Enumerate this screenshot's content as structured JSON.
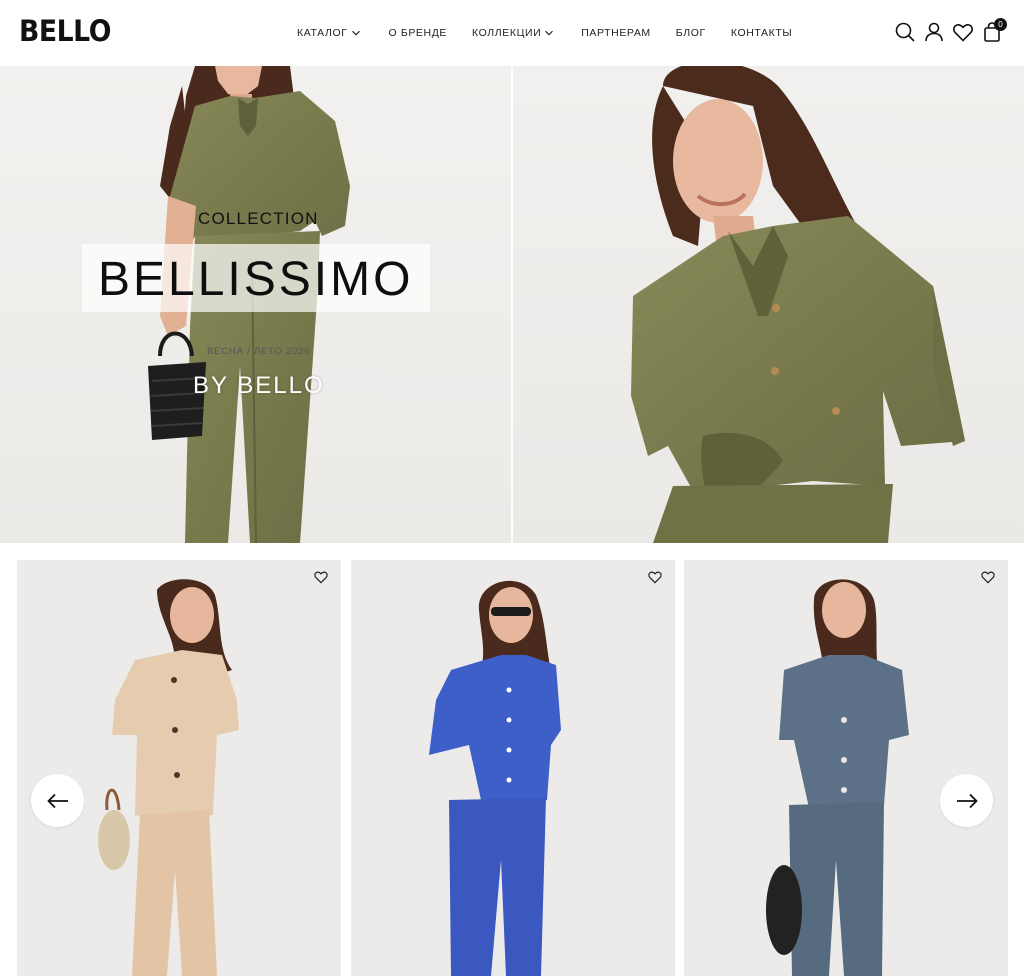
{
  "header": {
    "logo": "BELLO",
    "nav": [
      {
        "label": "КАТАЛОГ",
        "has_dropdown": true
      },
      {
        "label": "О БРЕНДЕ",
        "has_dropdown": false
      },
      {
        "label": "КОЛЛЕКЦИИ",
        "has_dropdown": true
      },
      {
        "label": "ПАРТНЕРАМ",
        "has_dropdown": false
      },
      {
        "label": "БЛОГ",
        "has_dropdown": false
      },
      {
        "label": "КОНТАКТЫ",
        "has_dropdown": false
      }
    ],
    "icons": [
      "search-icon",
      "user-icon",
      "heart-icon",
      "bag-icon"
    ],
    "cart_count": "0"
  },
  "hero": {
    "collection_label": "COLLECTION",
    "title": "BELLISSIMO",
    "season": "ВЕСНА / ЛЕТО 2026",
    "by_line": "BY BELLO"
  },
  "products": [
    {
      "color": "#e6ccae",
      "name": "beige-linen-suit"
    },
    {
      "color": "#3f5fc8",
      "name": "blue-shirt-suit"
    },
    {
      "color": "#5c7187",
      "name": "slate-jacket-suit"
    }
  ],
  "carousel": {
    "prev_icon": "arrow-left-icon",
    "next_icon": "arrow-right-icon"
  },
  "colors": {
    "olive": "#7d7f52",
    "olive_dark": "#686a42",
    "skin": "#e7b79e",
    "hair": "#4a2a1c",
    "background": "#f2f1ef"
  }
}
